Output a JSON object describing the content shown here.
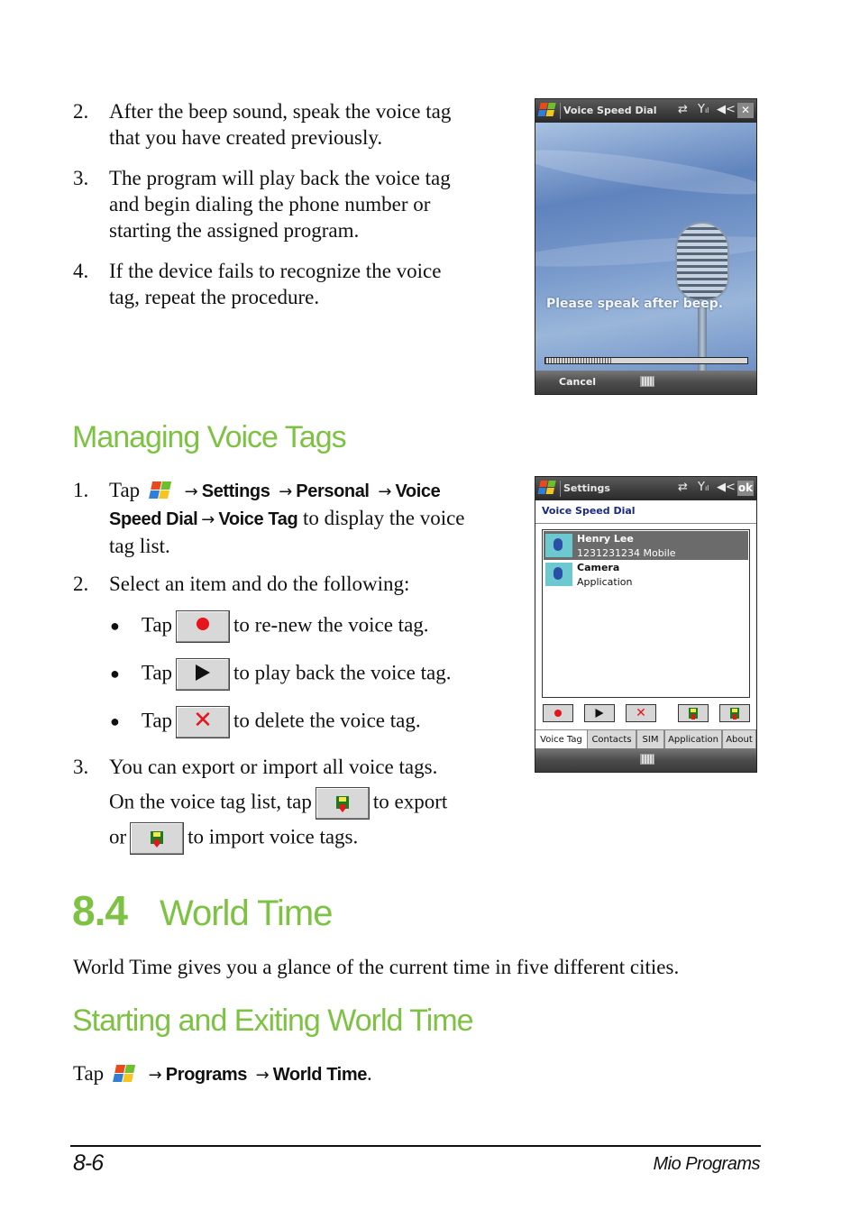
{
  "steps_top": [
    {
      "num": "2.",
      "lines": [
        "After the beep sound, speak the voice tag",
        "that you have created previously."
      ]
    },
    {
      "num": "3.",
      "lines": [
        "The program will play back the voice tag",
        "and begin dialing the phone number or",
        "starting the assigned program."
      ]
    },
    {
      "num": "4.",
      "lines": [
        "If the device fails to recognize the voice",
        "tag, repeat the procedure."
      ]
    }
  ],
  "screen1": {
    "title": "Voice Speed Dial",
    "icons": [
      "start-flag-icon",
      "connectivity-icon",
      "signal-icon",
      "volume-icon",
      "close-icon"
    ],
    "close_label": "✕",
    "prompt": "Please speak after beep.",
    "progress_percent": 33,
    "softkey_left": "Cancel",
    "keyboard_icon": "keyboard-icon"
  },
  "managing": {
    "heading": "Managing Voice Tags",
    "step1": {
      "num": "1.",
      "tap": "Tap",
      "path": [
        "Settings",
        "Personal",
        "Voice Speed Dial",
        "Voice Tag"
      ],
      "path_line1": [
        "Settings",
        "Personal",
        "Voice"
      ],
      "path_line2_bold1": "Speed Dial",
      "path_line2_bold2": "Voice Tag",
      "suffix_line2": " to display the voice",
      "line3": "tag list."
    },
    "step2": {
      "num": "2.",
      "text": "Select an item and do the following:"
    },
    "bullets": [
      {
        "tap": "Tap",
        "icon": "record-icon",
        "text": "to re-new the voice tag."
      },
      {
        "tap": "Tap",
        "icon": "play-icon",
        "text": "to play back the voice tag."
      },
      {
        "tap": "Tap",
        "icon": "delete-icon",
        "text": "to delete the voice tag."
      }
    ],
    "step3": {
      "num": "3.",
      "line1": "You can export or import all voice tags.",
      "line2_pre": "On the voice tag list, tap",
      "line2_post": "to export",
      "line3_pre": "or",
      "line3_post": "to import voice tags."
    }
  },
  "screen2": {
    "title": "Settings",
    "ok_label": "ok",
    "section_title": "Voice Speed Dial",
    "list": [
      {
        "name": "Henry Lee",
        "detail": "1231231234 Mobile",
        "selected": true
      },
      {
        "name": "Camera",
        "detail": "Application",
        "selected": false
      }
    ],
    "toolbar": [
      "record-icon",
      "play-icon",
      "delete-icon",
      "export-icon",
      "import-icon"
    ],
    "tabs": [
      "Voice Tag",
      "Contacts",
      "SIM",
      "Application",
      "About"
    ],
    "active_tab": "Voice Tag"
  },
  "section84": {
    "number": "8.4",
    "title": "World Time",
    "intro": "World Time gives you a glance of the current time in five different cities.",
    "sub_heading": "Starting and Exiting World Time",
    "tap": "Tap",
    "path": [
      "Programs",
      "World Time"
    ],
    "end": "."
  },
  "footer": {
    "page_number": "8-6",
    "chapter": "Mio Programs"
  },
  "colors": {
    "heading_green": "#7dc242",
    "record_red": "#e8141c",
    "tab_selected_bg": "#ffffff"
  }
}
